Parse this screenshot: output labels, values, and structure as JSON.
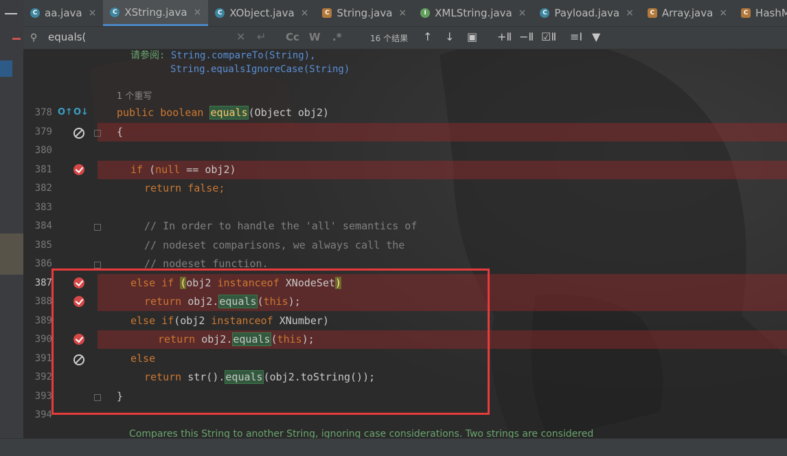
{
  "tabs": [
    {
      "label": "aa.java",
      "icon": "class-icon",
      "active": false
    },
    {
      "label": "XString.java",
      "icon": "class-icon",
      "active": true
    },
    {
      "label": "XObject.java",
      "icon": "class-icon",
      "active": false
    },
    {
      "label": "String.java",
      "icon": "class-icon",
      "active": false
    },
    {
      "label": "XMLString.java",
      "icon": "interface-icon",
      "active": false
    },
    {
      "label": "Payload.java",
      "icon": "class-icon",
      "active": false
    },
    {
      "label": "Array.java",
      "icon": "class-icon",
      "active": false
    },
    {
      "label": "HashMap",
      "icon": "class-icon",
      "active": false
    }
  ],
  "search": {
    "query": "equals(",
    "match_case": "Cc",
    "words": "W",
    "regex": ".*",
    "result_count": "16 个结果"
  },
  "doc": {
    "see_also_label": "请参阅:",
    "see_also_1": "String.compareTo(String),",
    "see_also_2": "String.equalsIgnoreCase(String)",
    "overrides": "1 个重写"
  },
  "lines": [
    {
      "num": "378"
    },
    {
      "num": "379"
    },
    {
      "num": "380"
    },
    {
      "num": "381"
    },
    {
      "num": "382"
    },
    {
      "num": "383"
    },
    {
      "num": "384"
    },
    {
      "num": "385"
    },
    {
      "num": "386"
    },
    {
      "num": "387"
    },
    {
      "num": "388"
    },
    {
      "num": "389"
    },
    {
      "num": "390"
    },
    {
      "num": "391"
    },
    {
      "num": "392"
    },
    {
      "num": "393"
    },
    {
      "num": "394"
    }
  ],
  "code": {
    "l378_a": "public boolean ",
    "l378_fn": "equals",
    "l378_b": "(Object obj2)",
    "l379": "{",
    "l381_kw": "if",
    "l381_a": " (",
    "l381_null": "null",
    "l381_b": " == obj2)",
    "l382_kw": "return",
    "l382_false": " false",
    "l382_c": ";",
    "l384": "// In order to handle the 'all' semantics of",
    "l385": "// nodeset comparisons, we always call the",
    "l386": "// nodeset function.",
    "l387_kw": "else if ",
    "l387_p": "(",
    "l387_a": "obj2 ",
    "l387_inst": "instanceof",
    "l387_b": " XNodeSet",
    "l387_p2": ")",
    "l388_kw": "return",
    "l388_a": " obj2.",
    "l388_eq": "equals",
    "l388_b": "(",
    "l388_this": "this",
    "l388_c": ");",
    "l389_kw": "else if",
    "l389_a": "(obj2 ",
    "l389_inst": "instanceof",
    "l389_b": " XNumber)",
    "l390_kw": "return",
    "l390_a": " obj2.",
    "l390_eq": "equals",
    "l390_b": "(",
    "l390_this": "this",
    "l390_c": ");",
    "l391_kw": "else",
    "l392_kw": "return",
    "l392_a": " str().",
    "l392_eq": "equals",
    "l392_b": "(obj2.toString());",
    "l393": "}"
  },
  "bottom_doc": "Compares this String to another String, ignoring case considerations. Two strings are considered",
  "colors": {
    "accent": "#4a88c7",
    "highlight_box": "#e83b3b",
    "breakpoint": "#d64848",
    "keyword": "#cc7832",
    "match_bg": "#32593d"
  }
}
